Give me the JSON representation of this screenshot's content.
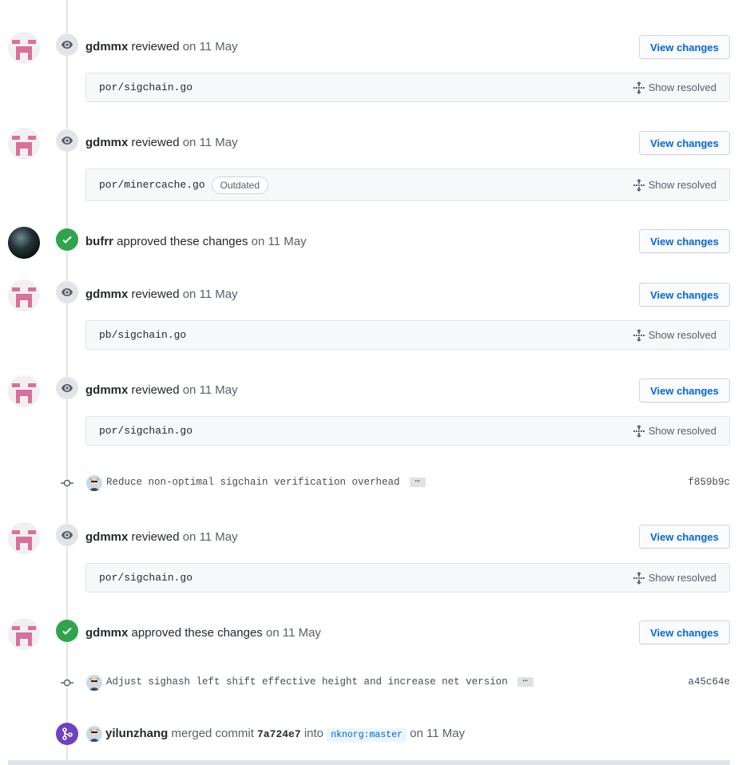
{
  "view_changes_label": "View changes",
  "show_resolved_label": "Show resolved",
  "outdated_label": "Outdated",
  "reviews": [
    {
      "author": "gdmmx",
      "action": "reviewed",
      "date": "on 11 May",
      "file": "por/sigchain.go"
    },
    {
      "author": "gdmmx",
      "action": "reviewed",
      "date": "on 11 May",
      "file": "por/minercache.go",
      "outdated": true
    },
    {
      "author": "bufrr",
      "action": "approved these changes",
      "date": "on 11 May"
    },
    {
      "author": "gdmmx",
      "action": "reviewed",
      "date": "on 11 May",
      "file": "pb/sigchain.go"
    },
    {
      "author": "gdmmx",
      "action": "reviewed",
      "date": "on 11 May",
      "file": "por/sigchain.go"
    },
    {
      "author": "gdmmx",
      "action": "reviewed",
      "date": "on 11 May",
      "file": "por/sigchain.go"
    },
    {
      "author": "gdmmx",
      "action": "approved these changes",
      "date": "on 11 May"
    }
  ],
  "commits": [
    {
      "message": "Reduce non-optimal sigchain verification overhead",
      "ellipsis": "…",
      "sha": "f859b9c"
    },
    {
      "message": "Adjust sighash left shift effective height and increase net version",
      "ellipsis": "…",
      "sha": "a45c64e"
    }
  ],
  "merge": {
    "author": "yilunzhang",
    "action": "merged commit",
    "sha": "7a724e7",
    "into": "into",
    "branch_owner": "nknorg",
    "branch_sep": ":",
    "branch_name": "master",
    "date": "on 11 May"
  },
  "colors": {
    "approved": "#2ea44f",
    "merged": "#6f42c1",
    "link": "#0366d6",
    "identicon": "#d9709b"
  }
}
